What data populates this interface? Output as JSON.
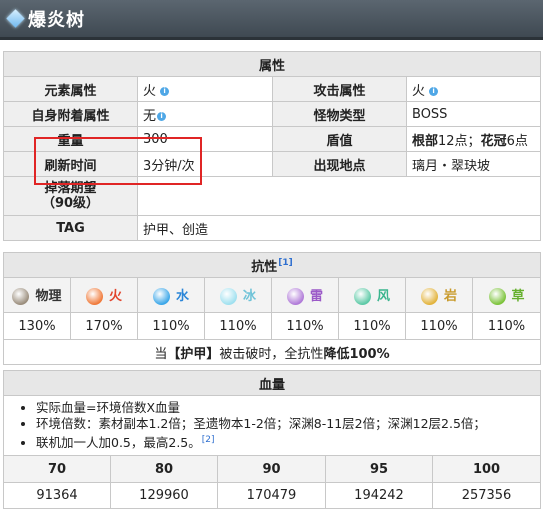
{
  "header": {
    "title": "爆炎树"
  },
  "attributes": {
    "section_title": "属性",
    "rows": [
      {
        "l1": "元素属性",
        "v1": "火",
        "l2": "攻击属性",
        "v2": "火"
      },
      {
        "l1": "自身附着属性",
        "v1": "无",
        "l2": "怪物类型",
        "v2": "BOSS"
      },
      {
        "l1": "重量",
        "v1": "300",
        "l2": "盾值",
        "v2a": "根部",
        "v2b": "12点；",
        "v2c": "花冠",
        "v2d": "6点"
      },
      {
        "l1": "刷新时间",
        "v1": "3分钟/次",
        "l2": "出现地点",
        "v2": "璃月・翠玦坡"
      }
    ],
    "drop_label_1": "掉落期望",
    "drop_label_2": "（90级）",
    "tag_label": "TAG",
    "tag_value": "护甲、创造"
  },
  "resistance": {
    "title": "抗性",
    "ref": "[1]",
    "elements": [
      {
        "name": "物理",
        "value": "130%",
        "color": "#333333",
        "icon": "physical-icon",
        "icon_color": "#9a8d7c"
      },
      {
        "name": "火",
        "value": "170%",
        "color": "#e2442c",
        "icon": "pyro-icon",
        "icon_color": "#f07a3a"
      },
      {
        "name": "水",
        "value": "110%",
        "color": "#2b86d8",
        "icon": "hydro-icon",
        "icon_color": "#3aa6e8"
      },
      {
        "name": "冰",
        "value": "110%",
        "color": "#6fc3d8",
        "icon": "cryo-icon",
        "icon_color": "#9fe0ef"
      },
      {
        "name": "雷",
        "value": "110%",
        "color": "#9b59c8",
        "icon": "electro-icon",
        "icon_color": "#b07ad8"
      },
      {
        "name": "风",
        "value": "110%",
        "color": "#3bb58e",
        "icon": "anemo-icon",
        "icon_color": "#5cc9a6"
      },
      {
        "name": "岩",
        "value": "110%",
        "color": "#c89a2a",
        "icon": "geo-icon",
        "icon_color": "#e2b33c"
      },
      {
        "name": "草",
        "value": "110%",
        "color": "#66b02e",
        "icon": "dendro-icon",
        "icon_color": "#7cc33a"
      }
    ],
    "note_pre": "当",
    "note_armor": "【护甲】",
    "note_mid": "被击破时，全抗性",
    "note_bold": "降低100%"
  },
  "hp": {
    "title": "血量",
    "bullets": [
      "实际血量=环境倍数X血量",
      "环境倍数：素材副本1.2倍；圣遗物本1-2倍；深渊8-11层2倍；深渊12层2.5倍；",
      "联机加一人加0.5，最高2.5。"
    ],
    "bullet_ref": "[2]",
    "levels": [
      "70",
      "80",
      "90",
      "95",
      "100"
    ],
    "values": [
      "91364",
      "129960",
      "170479",
      "194242",
      "257356"
    ]
  }
}
